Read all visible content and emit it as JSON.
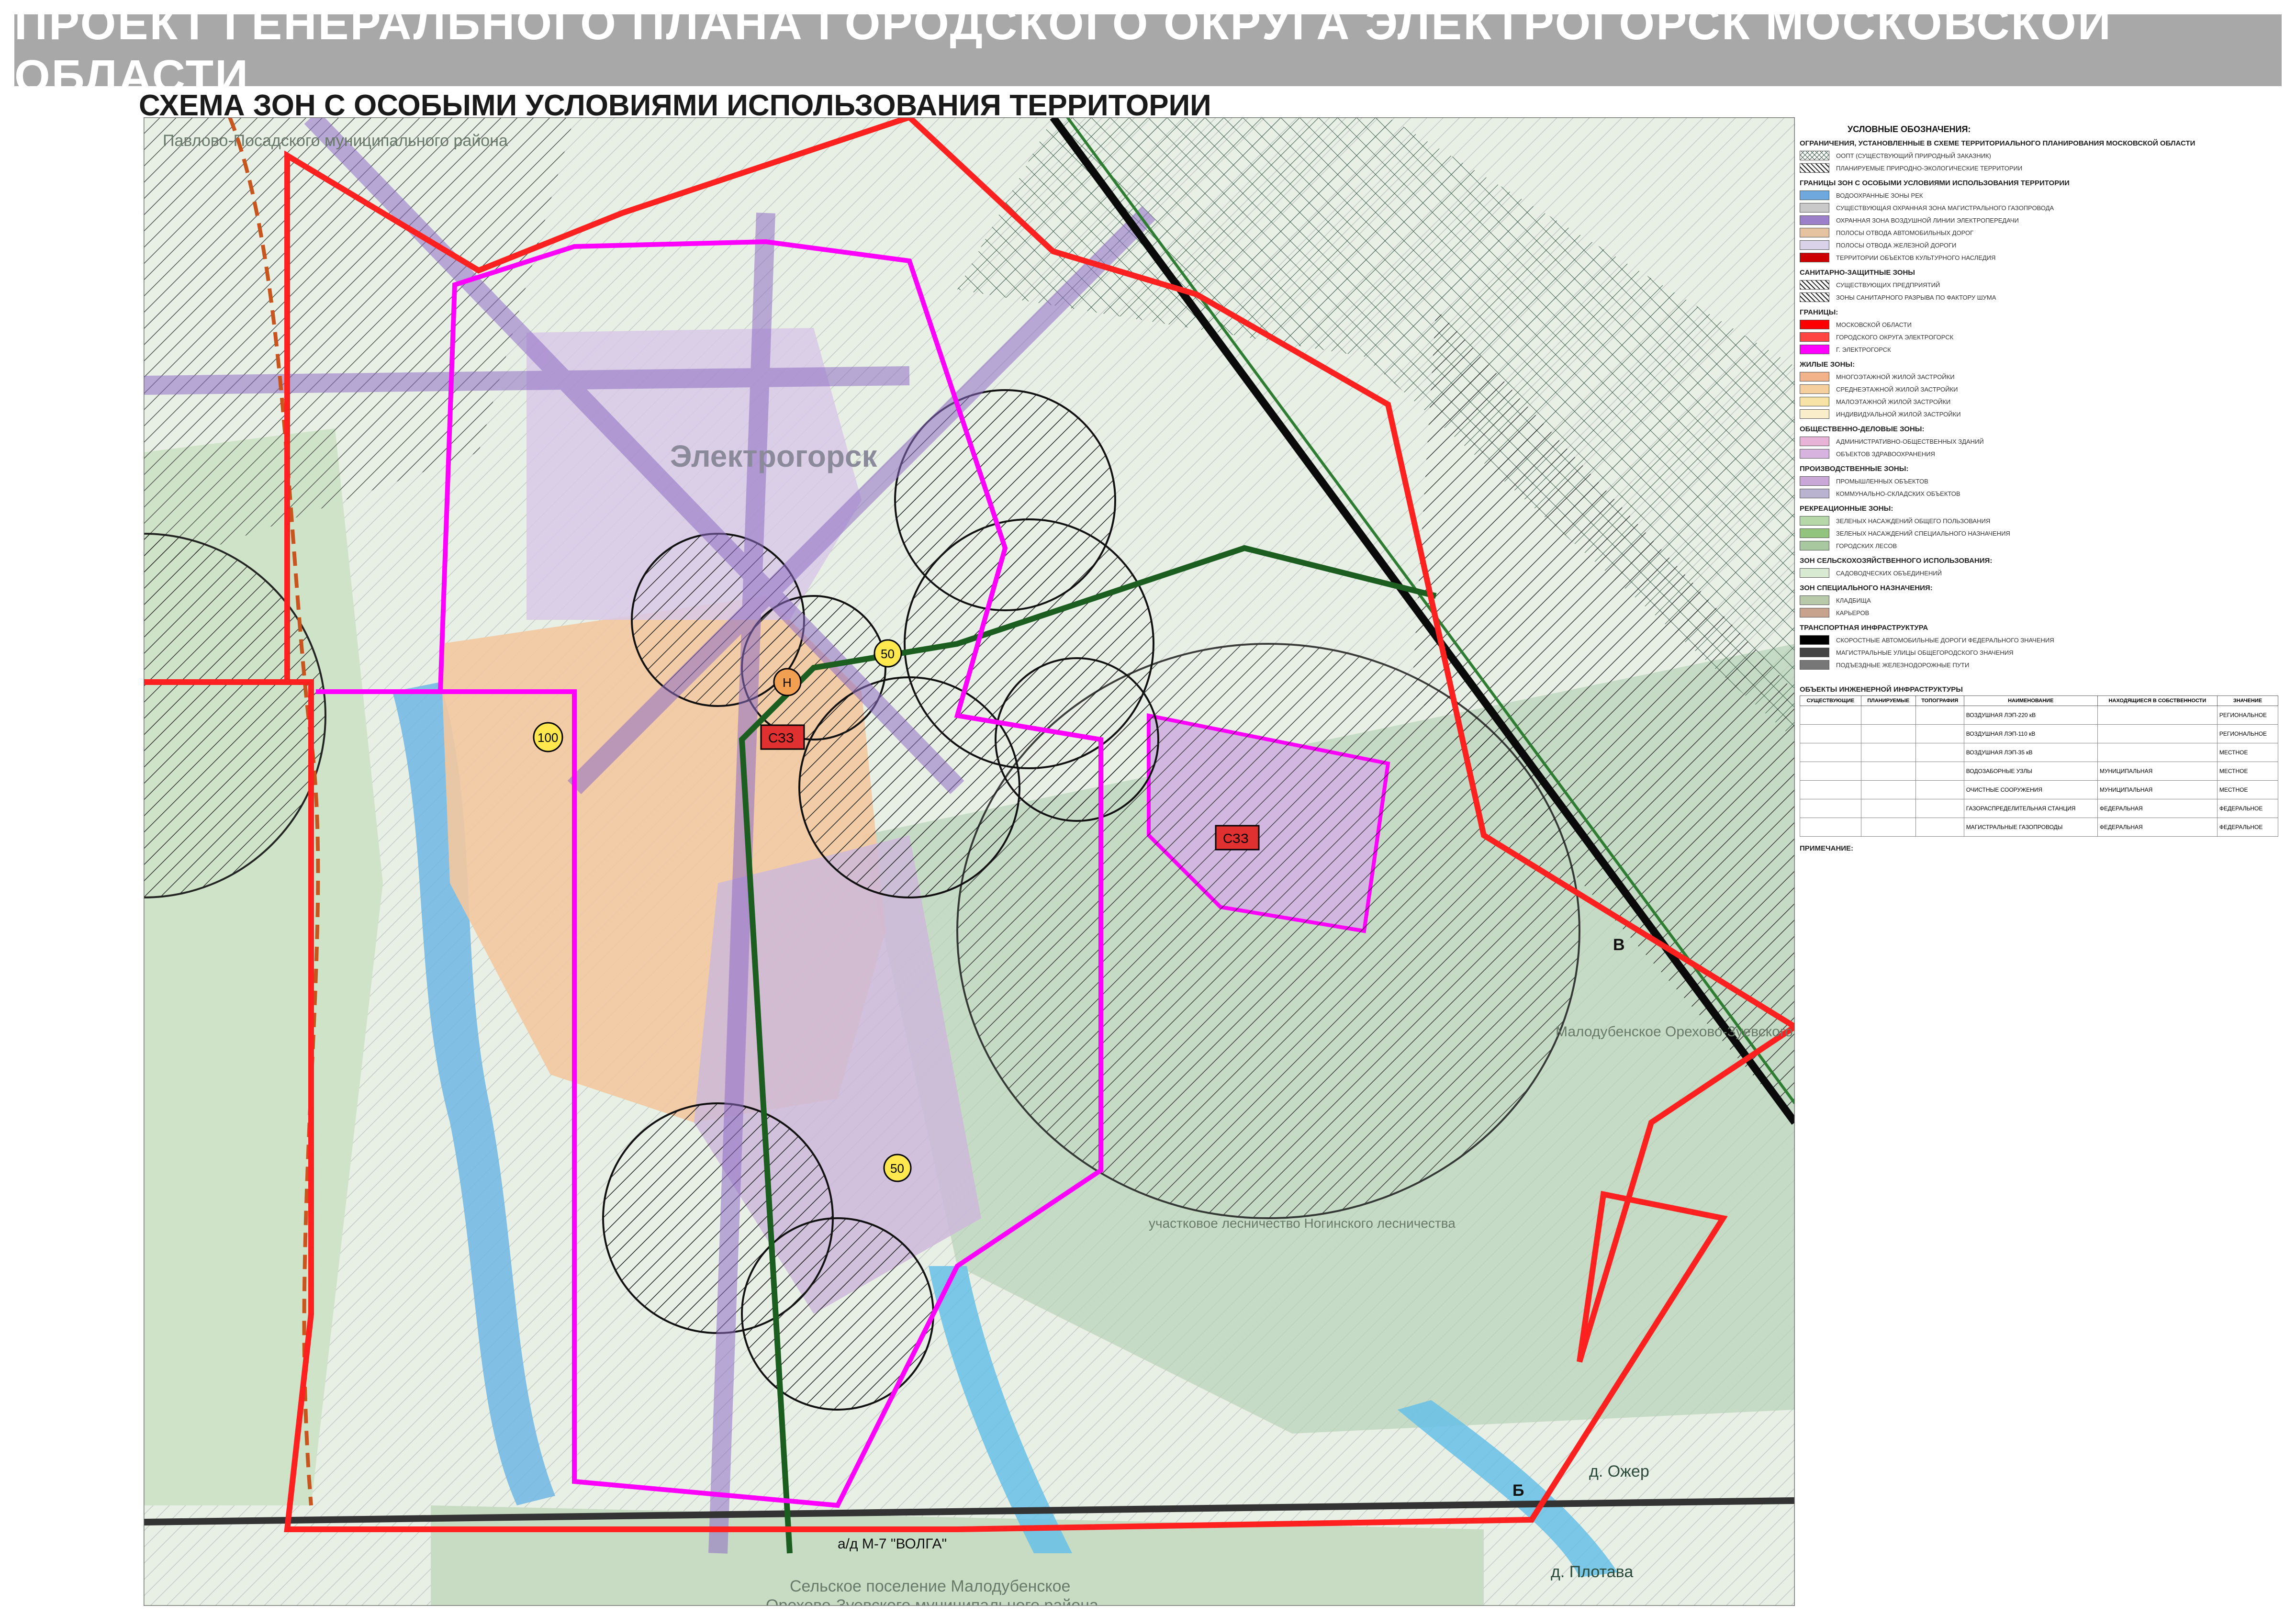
{
  "title": "ПРОЕКТ ГЕНЕРАЛЬНОГО ПЛАНА ГОРОДСКОГО ОКРУГА ЭЛЕКТРОГОРСК МОСКОВСКОЙ ОБЛАСТИ",
  "subtitle": "СХЕМА ЗОН С ОСОБЫМИ УСЛОВИЯМИ ИСПОЛЬЗОВАНИЯ ТЕРРИТОРИИ",
  "map": {
    "labels": {
      "city": "Электрогорск",
      "village_plotava": "д. Плотава",
      "village_ozhery": "д. Ожер",
      "road_volga": "а/д М-7 \"ВОЛГА\"",
      "point_b": "Б",
      "point_v": "В",
      "district_left": "Павлово-Посадского муниципального района",
      "district_bottom_1": "Сельское поселение Малодубенское",
      "district_bottom_2": "Орехово-Зуевского муниципального района",
      "district_right": "Малодубенское Орехово-Зуевского муниципального района",
      "forestry": "участковое лесничество Ногинского лесничества",
      "szz_1": "СЗЗ",
      "szz_2": "СЗЗ",
      "num_100": "100",
      "num_50a": "50",
      "num_50b": "50",
      "num_h": "Н"
    }
  },
  "legend": {
    "main": "УСЛОВНЫЕ ОБОЗНАЧЕНИЯ:",
    "sections": [
      {
        "heading": "ОГРАНИЧЕНИЯ, УСТАНОВЛЕННЫЕ В СХЕМЕ ТЕРРИТОРИАЛЬНОГО ПЛАНИРОВАНИЯ МОСКОВСКОЙ ОБЛАСТИ",
        "items": [
          {
            "label": "ООПТ (СУЩЕСТВУЮЩИЙ ПРИРОДНЫЙ ЗАКАЗНИК)",
            "color": "#ffffff",
            "pattern": "cross"
          },
          {
            "label": "ПЛАНИРУЕМЫЕ ПРИРОДНО-ЭКОЛОГИЧЕСКИЕ ТЕРРИТОРИИ",
            "color": "#ffffff",
            "pattern": "hatch"
          }
        ]
      },
      {
        "heading": "ГРАНИЦЫ ЗОН С ОСОБЫМИ УСЛОВИЯМИ ИСПОЛЬЗОВАНИЯ ТЕРРИТОРИИ",
        "items": [
          {
            "label": "ВОДООХРАННЫЕ ЗОНЫ РЕК",
            "color": "#6fa8dc",
            "pattern": "solid"
          },
          {
            "label": "СУЩЕСТВУЮЩАЯ ОХРАННАЯ ЗОНА МАГИСТРАЛЬНОГО ГАЗОПРОВОДА",
            "color": "#c9c9c9",
            "pattern": "solid"
          },
          {
            "label": "ОХРАННАЯ ЗОНА ВОЗДУШНОЙ ЛИНИИ ЭЛЕКТРОПЕРЕДАЧИ",
            "color": "#9b7fc9",
            "pattern": "solid"
          },
          {
            "label": "ПОЛОСЫ ОТВОДА АВТОМОБИЛЬНЫХ ДОРОГ",
            "color": "#e6c3a0",
            "pattern": "solid"
          },
          {
            "label": "ПОЛОСЫ ОТВОДА ЖЕЛЕЗНОЙ ДОРОГИ",
            "color": "#d9d2e9",
            "pattern": "solid"
          },
          {
            "label": "ТЕРРИТОРИИ ОБЪЕКТОВ КУЛЬТУРНОГО НАСЛЕДИЯ",
            "color": "#cc0000",
            "pattern": "solid"
          }
        ]
      },
      {
        "heading": "САНИТАРНО-ЗАЩИТНЫЕ ЗОНЫ",
        "items": [
          {
            "label": "СУЩЕСТВУЮЩИХ ПРЕДПРИЯТИЙ",
            "color": "#ffffff",
            "pattern": "hatch"
          },
          {
            "label": "ЗОНЫ САНИТАРНОГО РАЗРЫВА ПО ФАКТОРУ ШУМА",
            "color": "#ffffff",
            "pattern": "hatch"
          }
        ]
      },
      {
        "heading": "ГРАНИЦЫ:",
        "items": [
          {
            "label": "МОСКОВСКОЙ ОБЛАСТИ",
            "color": "#ff0000",
            "pattern": "solid"
          },
          {
            "label": "ГОРОДСКОГО ОКРУГА ЭЛЕКТРОГОРСК",
            "color": "#ff4444",
            "pattern": "solid"
          },
          {
            "label": "Г. ЭЛЕКТРОГОРСК",
            "color": "#ff00ff",
            "pattern": "solid"
          }
        ]
      },
      {
        "heading": "ЖИЛЫЕ ЗОНЫ:",
        "items": [
          {
            "label": "МНОГОЭТАЖНОЙ ЖИЛОЙ ЗАСТРОЙКИ",
            "color": "#f2b38a",
            "pattern": "solid"
          },
          {
            "label": "СРЕДНЕЭТАЖНОЙ ЖИЛОЙ ЗАСТРОЙКИ",
            "color": "#f6cf9f",
            "pattern": "solid"
          },
          {
            "label": "МАЛОЭТАЖНОЙ ЖИЛОЙ ЗАСТРОЙКИ",
            "color": "#f8e3a7",
            "pattern": "solid"
          },
          {
            "label": "ИНДИВИДУАЛЬНОЙ ЖИЛОЙ ЗАСТРОЙКИ",
            "color": "#f9eec9",
            "pattern": "solid"
          }
        ]
      },
      {
        "heading": "ОБЩЕСТВЕННО-ДЕЛОВЫЕ ЗОНЫ:",
        "items": [
          {
            "label": "АДМИНИСТРАТИВНО-ОБЩЕСТВЕННЫХ ЗДАНИЙ",
            "color": "#e7b3d6",
            "pattern": "solid"
          },
          {
            "label": "ОБЪЕКТОВ ЗДРАВООХРАНЕНИЯ",
            "color": "#d7b4e0",
            "pattern": "solid"
          }
        ]
      },
      {
        "heading": "ПРОИЗВОДСТВЕННЫЕ ЗОНЫ:",
        "items": [
          {
            "label": "ПРОМЫШЛЕННЫХ ОБЪЕКТОВ",
            "color": "#c9a7d6",
            "pattern": "solid"
          },
          {
            "label": "КОММУНАЛЬНО-СКЛАДСКИХ ОБЪЕКТОВ",
            "color": "#b9b3cf",
            "pattern": "solid"
          }
        ]
      },
      {
        "heading": "РЕКРЕАЦИОННЫЕ ЗОНЫ:",
        "items": [
          {
            "label": "ЗЕЛЕНЫХ НАСАЖДЕНИЙ ОБЩЕГО ПОЛЬЗОВАНИЯ",
            "color": "#b6d7a8",
            "pattern": "solid"
          },
          {
            "label": "ЗЕЛЕНЫХ НАСАЖДЕНИЙ СПЕЦИАЛЬНОГО НАЗНАЧЕНИЯ",
            "color": "#93c47d",
            "pattern": "solid"
          },
          {
            "label": "ГОРОДСКИХ ЛЕСОВ",
            "color": "#a8c9a0",
            "pattern": "solid"
          }
        ]
      },
      {
        "heading": "ЗОН СЕЛЬСКОХОЗЯЙСТВЕННОГО ИСПОЛЬЗОВАНИЯ:",
        "items": [
          {
            "label": "САДОВОДЧЕСКИХ ОБЪЕДИНЕНИЙ",
            "color": "#d9ead3",
            "pattern": "solid"
          }
        ]
      },
      {
        "heading": "ЗОН СПЕЦИАЛЬНОГО НАЗНАЧЕНИЯ:",
        "items": [
          {
            "label": "КЛАДБИЩА",
            "color": "#b7c9a8",
            "pattern": "solid"
          },
          {
            "label": "КАРЬЕРОВ",
            "color": "#c7a28c",
            "pattern": "solid"
          }
        ]
      },
      {
        "heading": "ТРАНСПОРТНАЯ ИНФРАСТРУКТУРА",
        "items": [
          {
            "label": "СКОРОСТНЫЕ АВТОМОБИЛЬНЫЕ ДОРОГИ ФЕДЕРАЛЬНОГО ЗНАЧЕНИЯ",
            "color": "#000000",
            "pattern": "solid"
          },
          {
            "label": "МАГИСТРАЛЬНЫЕ УЛИЦЫ ОБЩЕГОРОДСКОГО ЗНАЧЕНИЯ",
            "color": "#444444",
            "pattern": "solid"
          },
          {
            "label": "ПОДЪЕЗДНЫЕ ЖЕЛЕЗНОДОРОЖНЫЕ ПУТИ",
            "color": "#777777",
            "pattern": "solid"
          }
        ]
      }
    ],
    "table_heading": "ОБЪЕКТЫ ИНЖЕНЕРНОЙ ИНФРАСТРУКТУРЫ",
    "table_columns": [
      "СУЩЕСТВУЮЩИЕ",
      "ПЛАНИРУЕМЫЕ",
      "ТОПОГРАФИЯ",
      "НАИМЕНОВАНИЕ",
      "НАХОДЯЩИЕСЯ В СОБСТВЕННОСТИ",
      "ЗНАЧЕНИЕ"
    ],
    "table_rows": [
      [
        "",
        "",
        "",
        "ВОЗДУШНАЯ ЛЭП-220 кВ",
        "",
        "РЕГИОНАЛЬНОЕ"
      ],
      [
        "",
        "",
        "",
        "ВОЗДУШНАЯ ЛЭП-110 кВ",
        "",
        "РЕГИОНАЛЬНОЕ"
      ],
      [
        "",
        "",
        "",
        "ВОЗДУШНАЯ ЛЭП-35 кВ",
        "",
        "МЕСТНОЕ"
      ],
      [
        "",
        "",
        "",
        "ВОДОЗАБОРНЫЕ УЗЛЫ",
        "МУНИЦИПАЛЬНАЯ",
        "МЕСТНОЕ"
      ],
      [
        "",
        "",
        "",
        "ОЧИСТНЫЕ СООРУЖЕНИЯ",
        "МУНИЦИПАЛЬНАЯ",
        "МЕСТНОЕ"
      ],
      [
        "",
        "",
        "",
        "ГАЗОРАСПРЕДЕЛИТЕЛЬНАЯ СТАНЦИЯ",
        "ФЕДЕРАЛЬНАЯ",
        "ФЕДЕРАЛЬНОЕ"
      ],
      [
        "",
        "",
        "",
        "МАГИСТРАЛЬНЫЕ ГАЗОПРОВОДЫ",
        "ФЕДЕРАЛЬНАЯ",
        "ФЕДЕРАЛЬНОЕ"
      ]
    ],
    "note_label": "ПРИМЕЧАНИЕ:"
  }
}
